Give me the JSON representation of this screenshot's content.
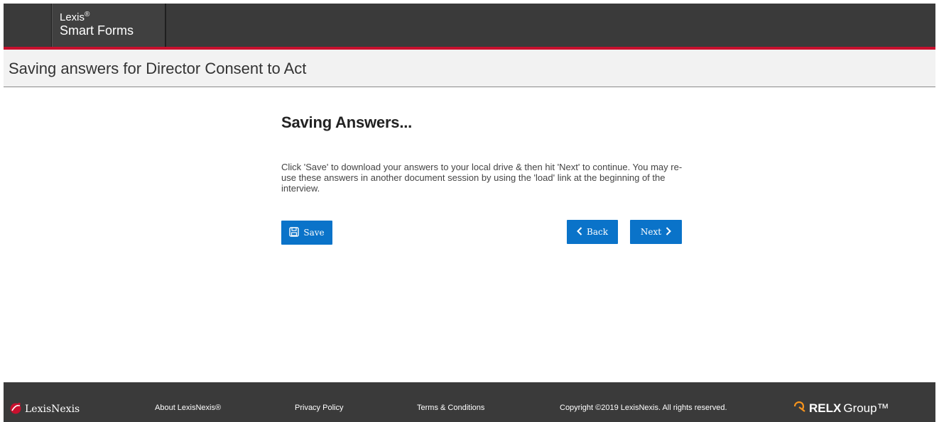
{
  "header": {
    "brand_line1": "Lexis",
    "brand_sup": "®",
    "brand_line2": "Smart Forms"
  },
  "page_title": "Saving answers for Director Consent to Act",
  "main": {
    "heading": "Saving Answers...",
    "instructions": "Click 'Save' to download your answers to your local drive & then hit 'Next' to continue. You may re-use these answers in another document session by using the 'load' link at the beginning of the interview.",
    "save_label": "Save",
    "back_label": "Back",
    "next_label": "Next"
  },
  "footer": {
    "logo_text": "LexisNexis",
    "about": "About LexisNexis®",
    "privacy": "Privacy Policy",
    "terms": "Terms & Conditions",
    "copyright": "Copyright ©2019 LexisNexis. All rights reserved.",
    "relx_strong": "RELX",
    "relx_light": "Group™"
  },
  "colors": {
    "header_bg": "#3a3a3a",
    "accent_red": "#c8102e",
    "button_blue": "#0a73c9",
    "relx_orange": "#f7941d"
  },
  "icons": [
    "save-icon",
    "chevron-left-icon",
    "chevron-right-icon",
    "lexisnexis-logo-icon",
    "relx-logo-icon"
  ]
}
